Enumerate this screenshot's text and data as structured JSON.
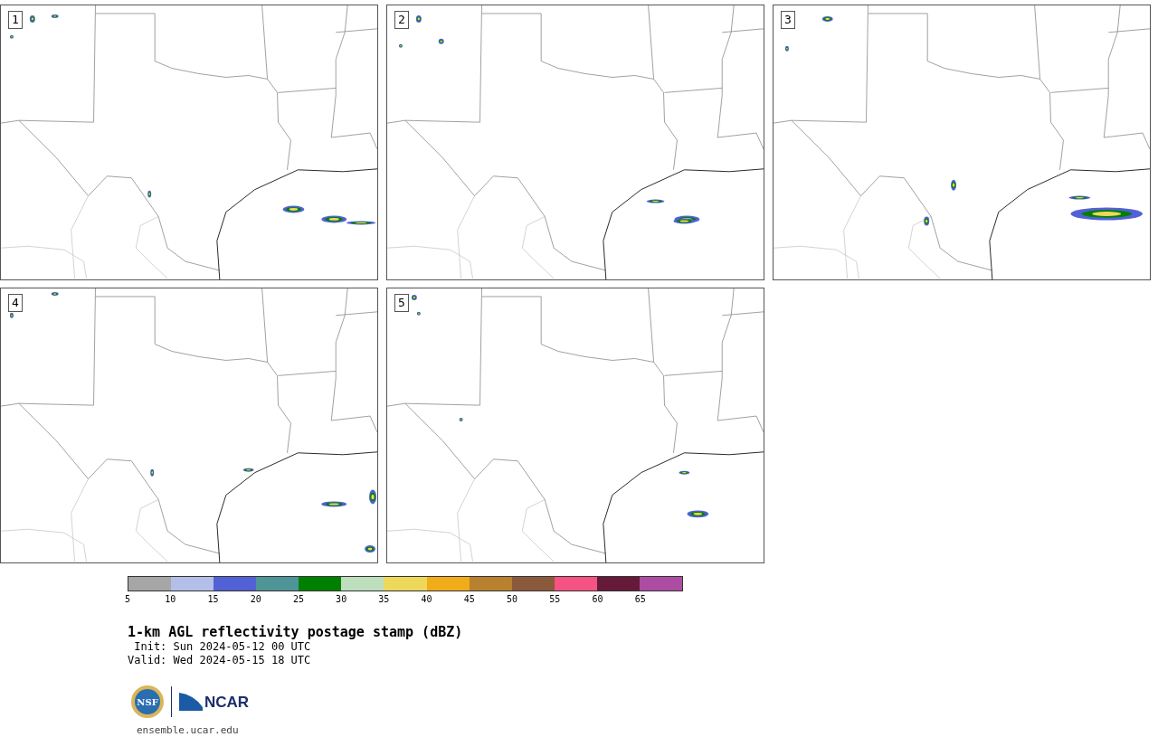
{
  "panels": [
    {
      "label": "1"
    },
    {
      "label": "2"
    },
    {
      "label": "3"
    },
    {
      "label": "4"
    },
    {
      "label": "5"
    }
  ],
  "colorbar": {
    "segments": [
      {
        "color": "#a6a6a6"
      },
      {
        "color": "#b4bfe9"
      },
      {
        "color": "#5261d6"
      },
      {
        "color": "#4f9598"
      },
      {
        "color": "#008000"
      },
      {
        "color": "#bedfbd"
      },
      {
        "color": "#eed85c"
      },
      {
        "color": "#f0ac19"
      },
      {
        "color": "#b8812f"
      },
      {
        "color": "#8b5a3c"
      },
      {
        "color": "#f55383"
      },
      {
        "color": "#661a3a"
      },
      {
        "color": "#ac4da3"
      }
    ],
    "ticks": [
      "5",
      "10",
      "15",
      "20",
      "25",
      "30",
      "35",
      "40",
      "45",
      "50",
      "55",
      "60",
      "65"
    ]
  },
  "title": "1-km AGL reflectivity postage stamp (dBZ)",
  "init": " Init: Sun 2024-05-12 00 UTC",
  "valid": "Valid: Wed 2024-05-15 18 UTC",
  "logos": {
    "nsf": "NSF",
    "ncar": "NCAR"
  },
  "url": "ensemble.ucar.edu"
}
